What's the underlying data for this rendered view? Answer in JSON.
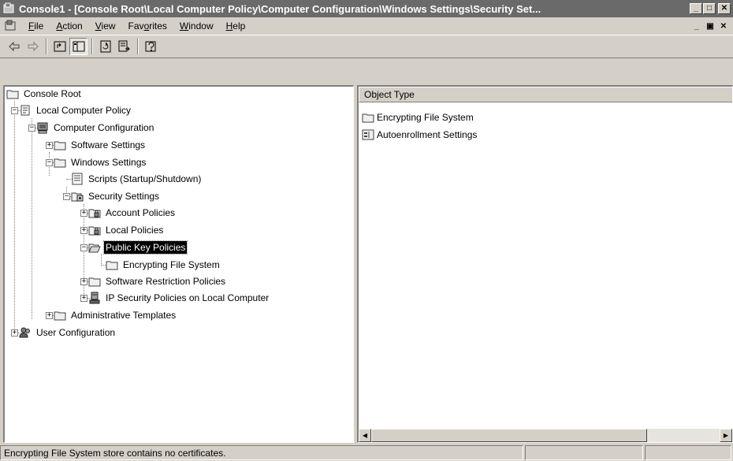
{
  "window": {
    "title": "Console1 - [Console Root\\Local Computer Policy\\Computer Configuration\\Windows Settings\\Security Set...",
    "icon": "mmc-console-icon"
  },
  "menu": {
    "items": [
      {
        "pre": "",
        "u": "F",
        "post": "ile"
      },
      {
        "pre": "",
        "u": "A",
        "post": "ction"
      },
      {
        "pre": "",
        "u": "V",
        "post": "iew"
      },
      {
        "pre": "Fav",
        "u": "o",
        "post": "rites"
      },
      {
        "pre": "",
        "u": "W",
        "post": "indow"
      },
      {
        "pre": "",
        "u": "H",
        "post": "elp"
      }
    ]
  },
  "tree": {
    "items": [
      {
        "label": "Console Root",
        "icon": "folder-icon"
      },
      {
        "label": "Local Computer Policy",
        "icon": "policy-scroll-icon"
      },
      {
        "label": "Computer Configuration",
        "icon": "computer-icon"
      },
      {
        "label": "Software Settings",
        "icon": "folder-icon"
      },
      {
        "label": "Windows Settings",
        "icon": "folder-icon"
      },
      {
        "label": "Scripts (Startup/Shutdown)",
        "icon": "script-icon"
      },
      {
        "label": "Security Settings",
        "icon": "security-settings-icon"
      },
      {
        "label": "Account Policies",
        "icon": "locked-folder-icon"
      },
      {
        "label": "Local Policies",
        "icon": "locked-folder-icon"
      },
      {
        "label": "Public Key Policies",
        "icon": "open-folder-icon",
        "selected": true
      },
      {
        "label": "Encrypting File System",
        "icon": "folder-icon"
      },
      {
        "label": "Software Restriction Policies",
        "icon": "folder-icon"
      },
      {
        "label": "IP Security Policies on Local Computer",
        "icon": "ip-security-icon"
      },
      {
        "label": "Administrative Templates",
        "icon": "folder-icon"
      },
      {
        "label": "User Configuration",
        "icon": "users-icon"
      }
    ]
  },
  "details": {
    "column_header": "Object Type",
    "rows": [
      {
        "label": "Encrypting File System",
        "icon": "folder-icon"
      },
      {
        "label": "Autoenrollment Settings",
        "icon": "settings-icon"
      }
    ]
  },
  "status": {
    "text": "Encrypting File System store contains no certificates."
  }
}
